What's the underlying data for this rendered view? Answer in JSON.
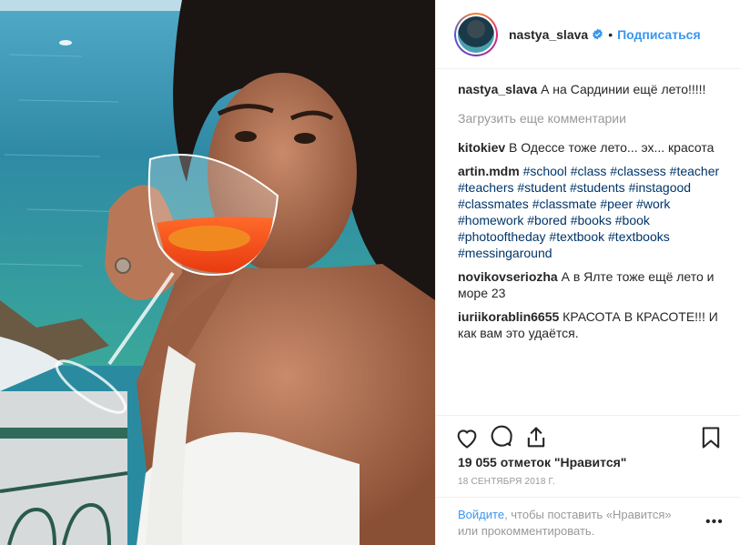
{
  "post": {
    "username": "nastya_slava",
    "follow_label": "Подписаться",
    "dot": "•",
    "caption": {
      "user": "nastya_slava",
      "text": "А на Сардинии ещё лето!!!!!"
    },
    "load_more": "Загрузить еще комментарии",
    "comments": [
      {
        "user": "kitokiev",
        "text": "В Одессе тоже лето... эх... красота"
      },
      {
        "user": "artin.mdm",
        "text": "#school #class #classess #teacher #teachers #student #students #instagood #classmates #classmate #peer #work #homework #bored #books #book #photooftheday #textbook #textbooks #messingaround"
      },
      {
        "user": "novikovseriozha",
        "text": "А в Ялте тоже ещё лето и море 23"
      },
      {
        "user": "iuriikorablin6655",
        "text": "КРАСОТА В КРАСОТЕ!!! И как вам это удаётся."
      }
    ],
    "likes": "19 055 отметок \"Нравится\"",
    "date": "18 СЕНТЯБРЯ 2018 Г.",
    "footer": {
      "login": "Войдите",
      "rest": ", чтобы поставить «Нравится» или прокомментировать."
    },
    "more": "•••"
  },
  "icons": [
    "heart-icon",
    "comment-icon",
    "share-icon",
    "bookmark-icon",
    "verified-badge-icon",
    "more-options-icon"
  ],
  "colors": {
    "link": "#3897f0",
    "hashtag": "#003569",
    "muted": "#999999",
    "text": "#262626"
  }
}
